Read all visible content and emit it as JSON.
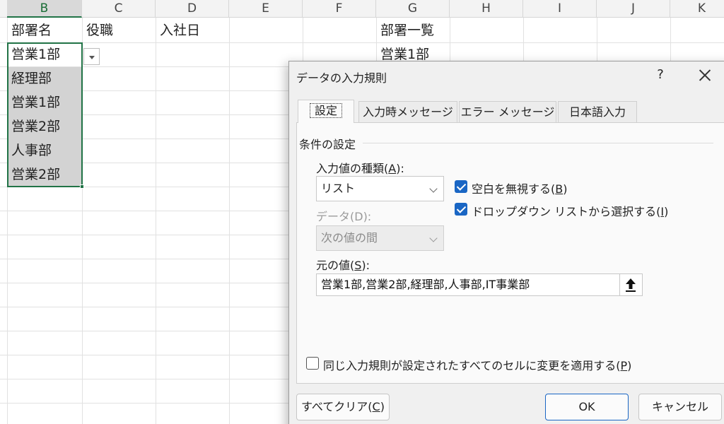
{
  "sheet": {
    "columns": [
      "B",
      "C",
      "D",
      "E",
      "F",
      "G",
      "H",
      "I",
      "J",
      "K"
    ],
    "selected_column": "B",
    "headers_row": {
      "b": "部署名",
      "c": "役職",
      "d": "入社日",
      "g": "部署一覧"
    },
    "b_values": [
      "営業1部",
      "経理部",
      "営業1部",
      "営業2部",
      "人事部",
      "営業2部"
    ],
    "g_values": [
      "営業1部"
    ]
  },
  "dialog": {
    "title": "データの入力規則",
    "help": "?",
    "tabs": [
      "設定",
      "入力時メッセージ",
      "エラー メッセージ",
      "日本語入力"
    ],
    "active_tab": "設定",
    "group_title": "条件の設定",
    "allow": {
      "label_pre": "入力値の種類(",
      "label_key": "A",
      "label_post": "):",
      "value": "リスト"
    },
    "data": {
      "label": "データ(D):",
      "value": "次の値の間"
    },
    "ignore_blank": {
      "pre": "空白を無視する(",
      "key": "B",
      "post": ")",
      "checked": true
    },
    "in_cell_dropdown": {
      "pre": "ドロップダウン リストから選択する(",
      "key": "I",
      "post": ")",
      "checked": true
    },
    "source": {
      "label_pre": "元の値(",
      "label_key": "S",
      "label_post": "):",
      "value": "営業1部,営業2部,経理部,人事部,IT事業部"
    },
    "apply_all": {
      "pre": "同じ入力規則が設定されたすべてのセルに変更を適用する(",
      "key": "P",
      "post": ")",
      "checked": false
    },
    "clear_all": {
      "pre": "すべてクリア(",
      "key": "C",
      "post": ")"
    },
    "ok_label": "OK",
    "cancel_label": "キャンセル"
  },
  "colors": {
    "excel_green": "#217346",
    "accent_blue": "#1a66c4",
    "selection_gray": "#d3d3d3"
  }
}
